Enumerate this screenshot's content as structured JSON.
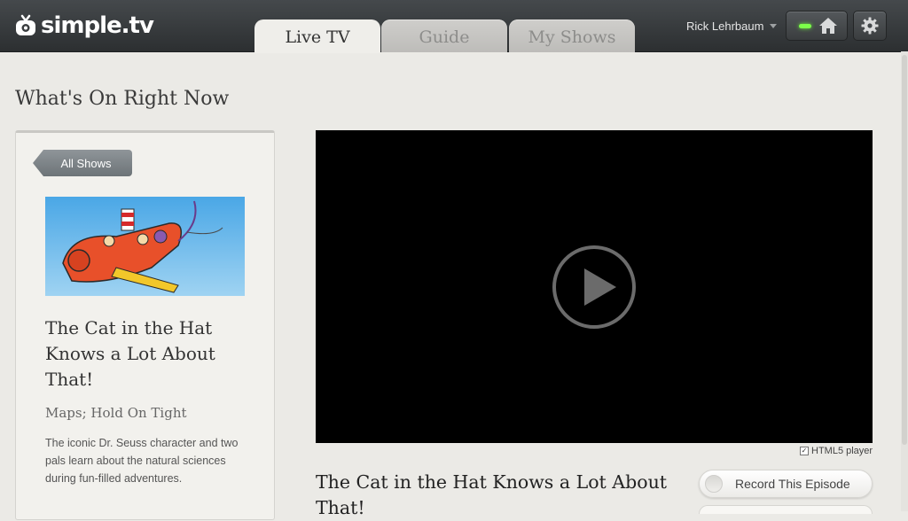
{
  "app": {
    "logo_text": "simple.tv",
    "user_name": "Rick Lehrbaum"
  },
  "tabs": [
    {
      "label": "Live TV",
      "active": true
    },
    {
      "label": "Guide",
      "active": false
    },
    {
      "label": "My Shows",
      "active": false
    }
  ],
  "toolbar": {
    "home_icon": "home-icon",
    "settings_icon": "gear-icon",
    "status_color": "#7dff4a"
  },
  "page": {
    "title": "What's On Right Now"
  },
  "sidebar": {
    "back_label": "All Shows",
    "show_title": "The Cat in the Hat Knows a Lot About That!",
    "episode_title": "Maps; Hold On Tight",
    "description": "The iconic Dr. Seuss character and two pals learn about the natural sciences during fun-filled adventures."
  },
  "player": {
    "html5_label": "HTML5 player",
    "html5_checked": true
  },
  "main": {
    "show_title": "The Cat in the Hat Knows a Lot About That!",
    "record_label": "Record This Episode"
  }
}
